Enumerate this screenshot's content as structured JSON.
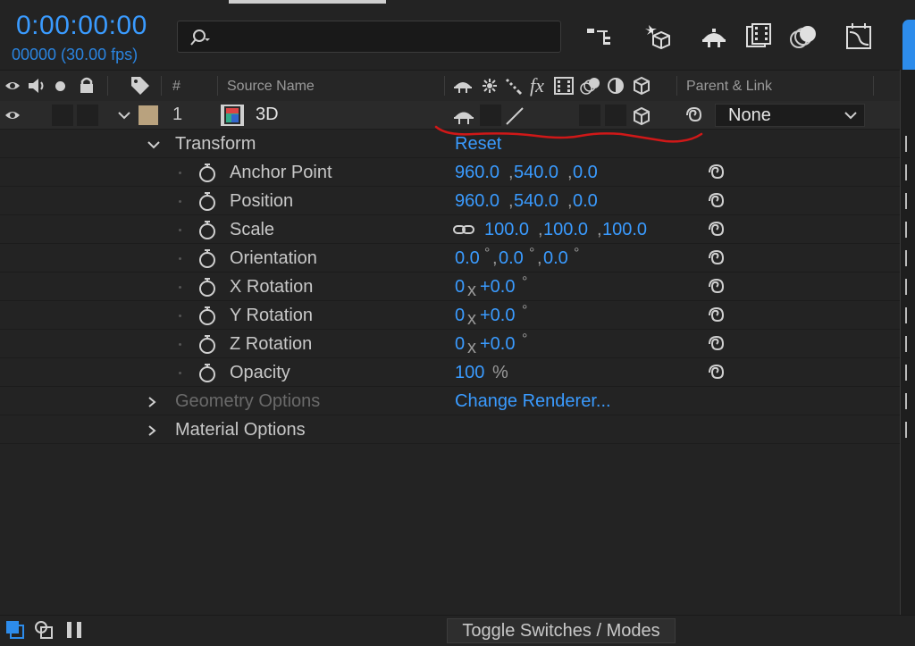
{
  "header": {
    "timecode": "0:00:00:00",
    "frame_info": "00000 (30.00 fps)",
    "search_placeholder": ""
  },
  "columns": {
    "number": "#",
    "source_name": "Source Name",
    "parent_link": "Parent & Link",
    "fx": "fx"
  },
  "layer": {
    "index": "1",
    "name": "3D",
    "parent": "None",
    "label_color": "#b9a27e"
  },
  "groups": {
    "transform": {
      "label": "Transform",
      "reset": "Reset"
    },
    "geometry": {
      "label": "Geometry Options",
      "action": "Change Renderer..."
    },
    "material": {
      "label": "Material Options"
    }
  },
  "properties": {
    "anchor": {
      "label": "Anchor Point",
      "v1": "960.0",
      "v2": "540.0",
      "v3": "0.0"
    },
    "position": {
      "label": "Position",
      "v1": "960.0",
      "v2": "540.0",
      "v3": "0.0"
    },
    "scale": {
      "label": "Scale",
      "v1": "100.0",
      "v2": "100.0",
      "v3": "100.0"
    },
    "orientation": {
      "label": "Orientation",
      "v1": "0.0",
      "v2": "0.0",
      "v3": "0.0"
    },
    "xrot": {
      "label": "X Rotation",
      "turns": "0",
      "deg": "+0.0"
    },
    "yrot": {
      "label": "Y Rotation",
      "turns": "0",
      "deg": "+0.0"
    },
    "zrot": {
      "label": "Z Rotation",
      "turns": "0",
      "deg": "+0.0"
    },
    "opacity": {
      "label": "Opacity",
      "value": "100",
      "unit": "%"
    }
  },
  "symbols": {
    "comma": ",",
    "degree": "°",
    "x": "x"
  },
  "footer": {
    "toggle": "Toggle Switches / Modes"
  },
  "colors": {
    "accent": "#3a9bff",
    "annotation": "#d01818"
  }
}
